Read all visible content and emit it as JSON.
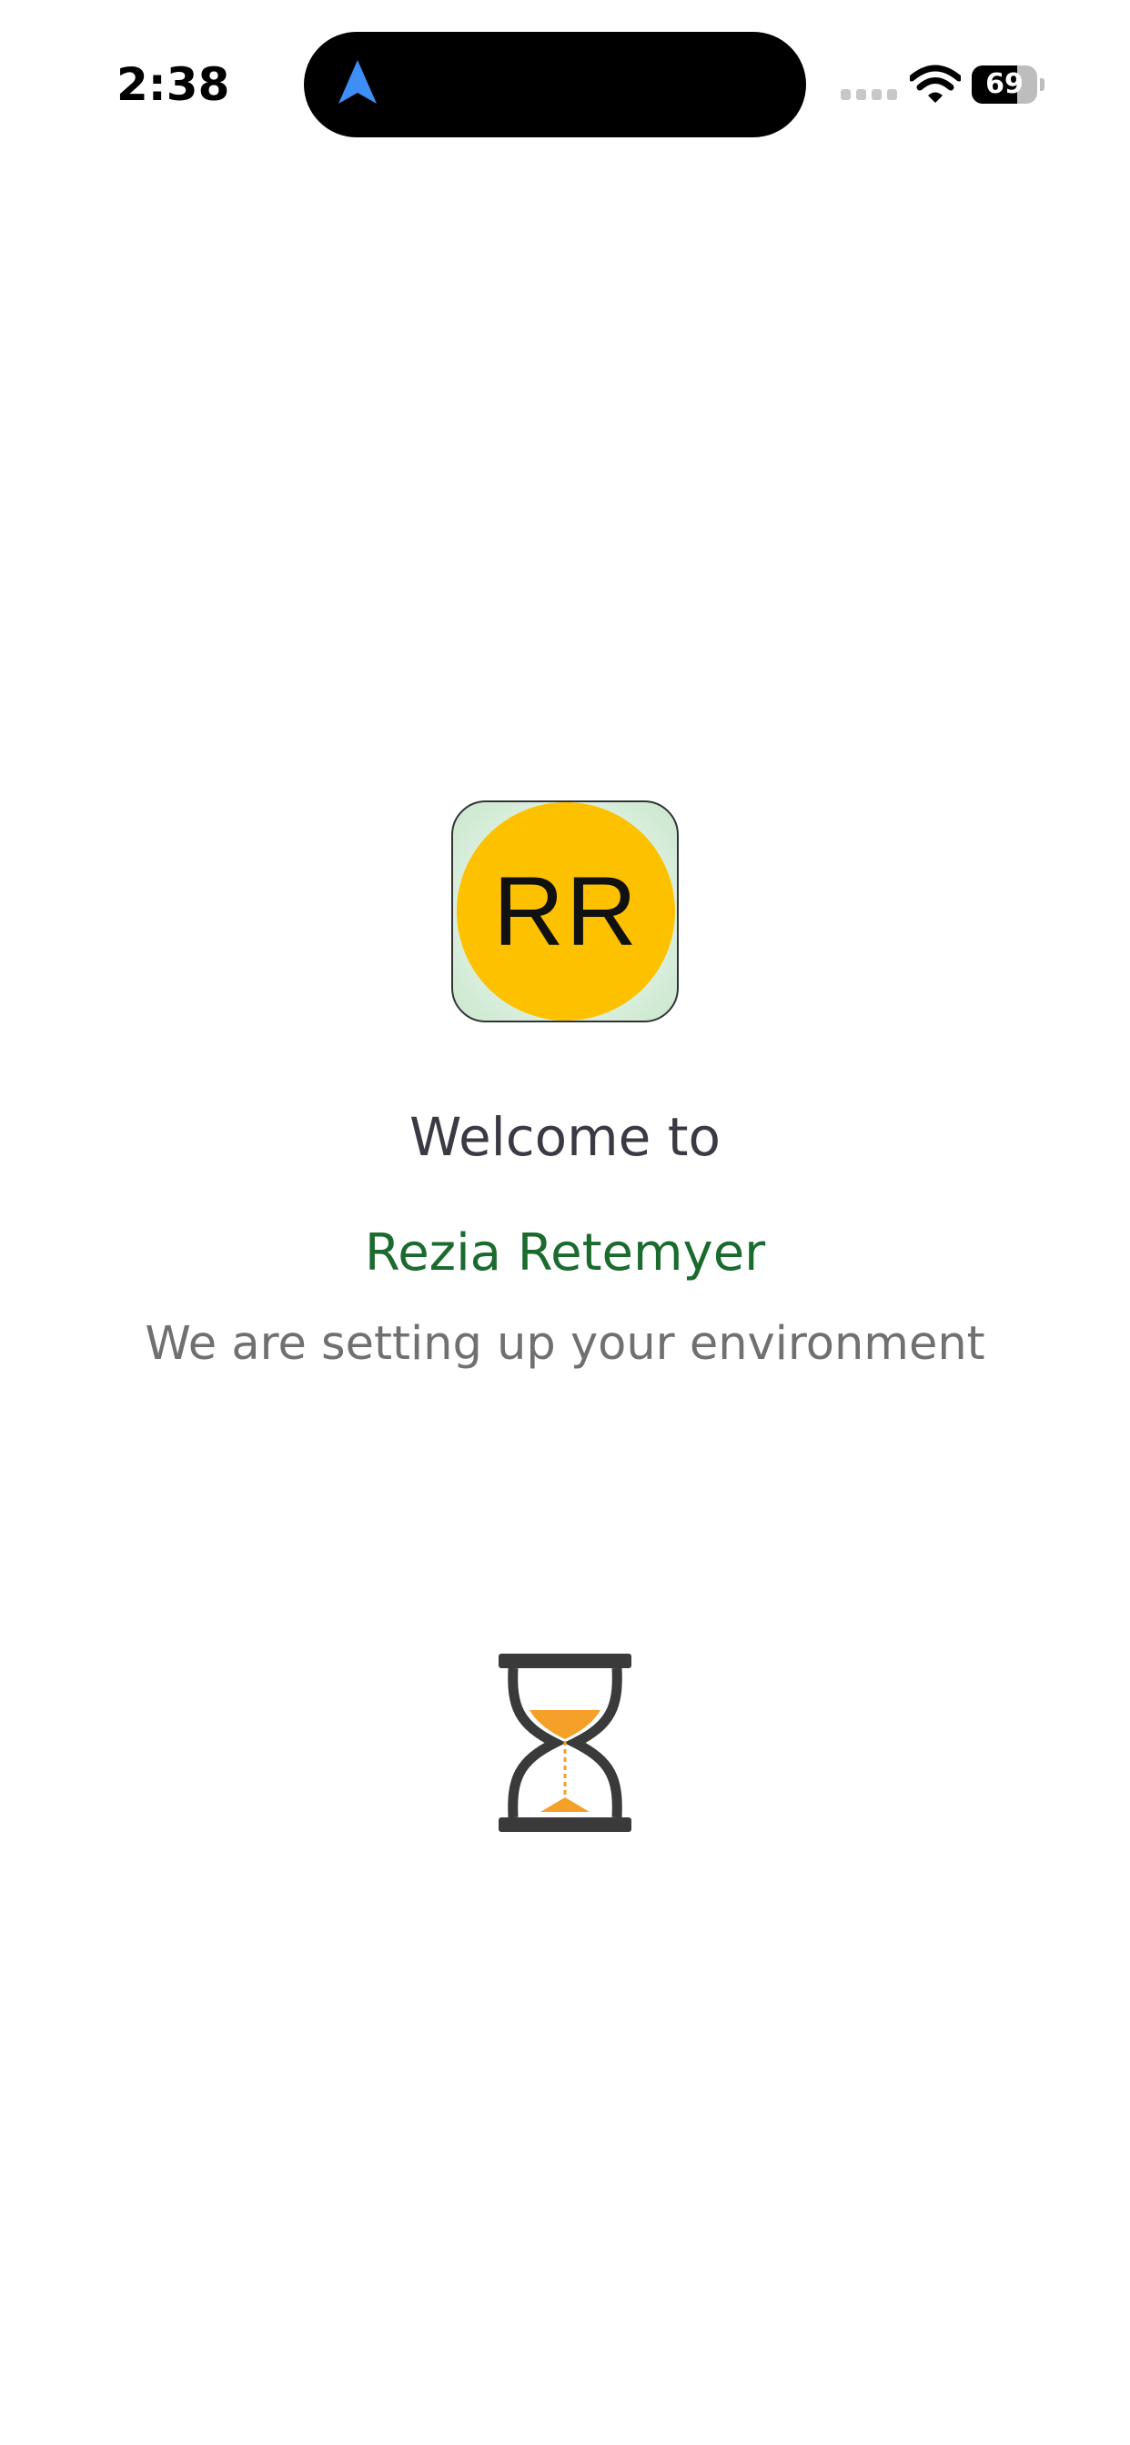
{
  "status_bar": {
    "time": "2:38",
    "battery_level": "69",
    "battery_fraction": 0.69,
    "icons": [
      "location-arrow-icon",
      "cellular-signal-icon",
      "wifi-icon",
      "battery-icon"
    ]
  },
  "logo": {
    "initials": "RR",
    "circle_color": "#fdc100",
    "background_tint": "#c9e6cd"
  },
  "welcome": {
    "greeting": "Welcome to",
    "organization": "Rezia Retemyer",
    "message": "We are setting up your environment"
  },
  "loading": {
    "icon": "hourglass-icon",
    "sand_color": "#f5a028"
  },
  "colors": {
    "greeting_text": "#3a3a45",
    "organization_text": "#1b6b2e",
    "message_text": "#707070",
    "location_arrow": "#3d8ef5"
  }
}
